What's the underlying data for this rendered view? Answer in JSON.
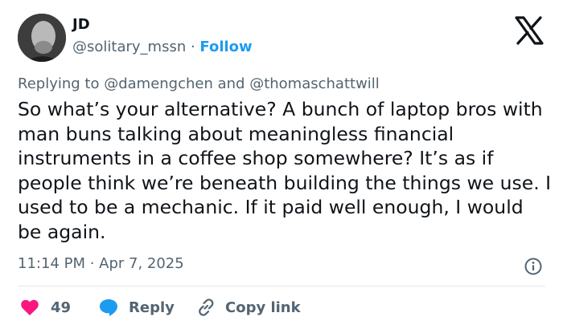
{
  "author": {
    "name": "JD",
    "handle": "@solitary_mssn",
    "separator": " · ",
    "follow_label": "Follow"
  },
  "reply_context": {
    "prefix": "Replying to ",
    "mention1": "@damengchen",
    "joiner": " and ",
    "mention2": "@thomaschattwill"
  },
  "tweet": {
    "text": "So what’s your alternative? A bunch of laptop bros with man buns talking about meaningless financial instruments in a coffee shop somewhere? It’s as if people think we’re beneath building the things we use. I used to be a mechanic. If it paid well enough, I would be again.",
    "timestamp": "11:14 PM · Apr 7, 2025"
  },
  "actions": {
    "like_count": "49",
    "reply_label": "Reply",
    "copy_label": "Copy link"
  },
  "colors": {
    "accent": "#1d9bf0",
    "like": "#f91880",
    "secondary_text": "#536471"
  },
  "icons": [
    "x-logo-icon",
    "info-icon",
    "heart-icon",
    "reply-bubble-icon",
    "link-icon"
  ]
}
